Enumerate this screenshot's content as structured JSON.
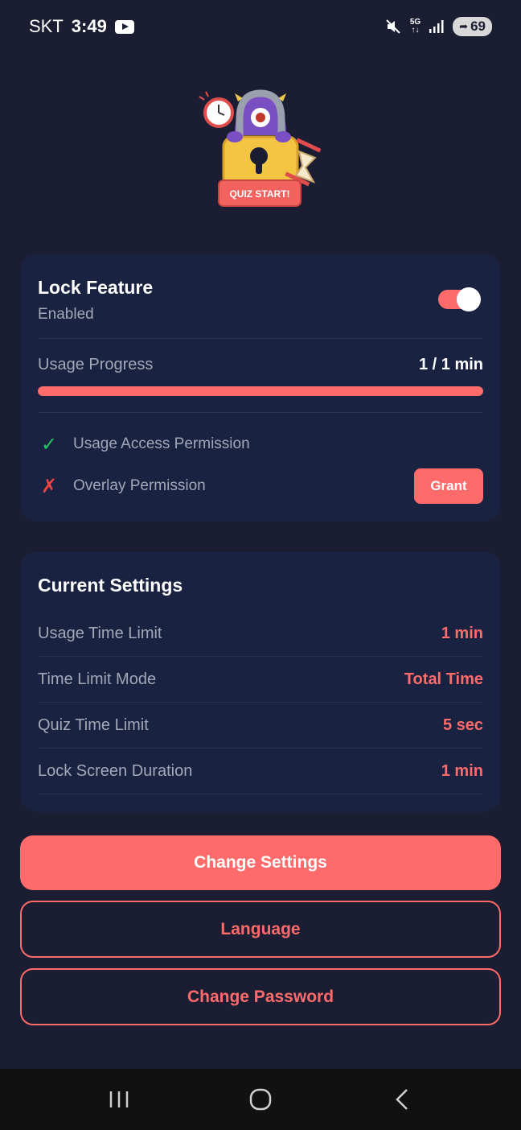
{
  "status_bar": {
    "carrier": "SKT",
    "time": "3:49",
    "network": "5G",
    "battery": "69",
    "icons": [
      "youtube-icon",
      "mute-icon",
      "5g-icon",
      "signal-icon",
      "battery-icon"
    ]
  },
  "mascot": {
    "badge_text": "QUIZ START!"
  },
  "lock_card": {
    "title": "Lock Feature",
    "status": "Enabled",
    "toggle_on": true,
    "usage_label": "Usage Progress",
    "usage_value": "1 / 1 min",
    "usage_fraction": 1.0,
    "permissions": [
      {
        "label": "Usage Access Permission",
        "granted": true,
        "icon": "✓"
      },
      {
        "label": "Overlay Permission",
        "granted": false,
        "icon": "✗",
        "action": "Grant"
      }
    ]
  },
  "settings_card": {
    "title": "Current Settings",
    "rows": [
      {
        "label": "Usage Time Limit",
        "value": "1 min"
      },
      {
        "label": "Time Limit Mode",
        "value": "Total Time"
      },
      {
        "label": "Quiz Time Limit",
        "value": "5 sec"
      },
      {
        "label": "Lock Screen Duration",
        "value": "1 min"
      }
    ]
  },
  "actions": {
    "change_settings": "Change Settings",
    "language": "Language",
    "change_password": "Change Password"
  },
  "colors": {
    "background": "#1b1d32",
    "card": "#192240",
    "accent": "#ff6b6b",
    "success": "#22c55e",
    "error": "#ef4444",
    "muted_text": "#a3a8b8"
  }
}
